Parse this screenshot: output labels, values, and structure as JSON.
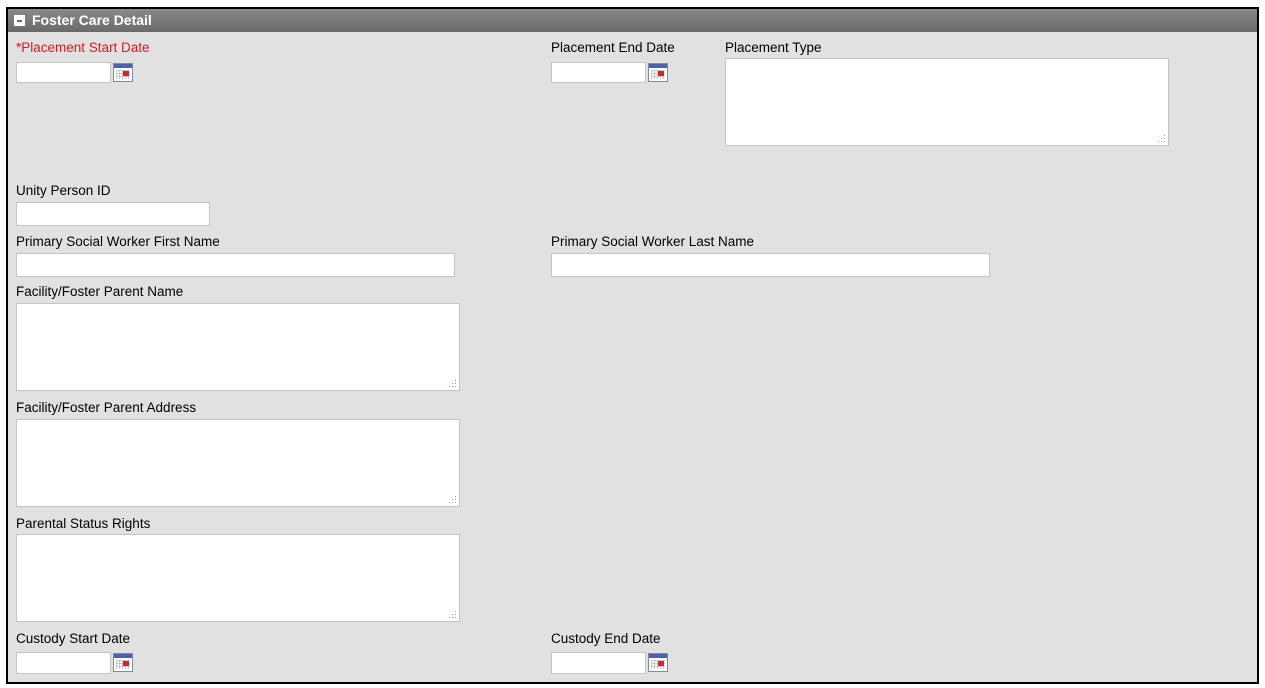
{
  "section": {
    "title": "Foster Care Detail"
  },
  "fields": {
    "placement_start_date": {
      "label": "*Placement Start Date",
      "value": ""
    },
    "placement_end_date": {
      "label": "Placement End Date",
      "value": ""
    },
    "placement_type": {
      "label": "Placement Type",
      "value": ""
    },
    "unity_person_id": {
      "label": "Unity Person ID",
      "value": ""
    },
    "primary_sw_first_name": {
      "label": "Primary Social Worker First Name",
      "value": ""
    },
    "primary_sw_last_name": {
      "label": "Primary Social Worker Last Name",
      "value": ""
    },
    "facility_parent_name": {
      "label": "Facility/Foster Parent Name",
      "value": ""
    },
    "facility_parent_address": {
      "label": "Facility/Foster Parent Address",
      "value": ""
    },
    "parental_status_rights": {
      "label": "Parental Status Rights",
      "value": ""
    },
    "custody_start_date": {
      "label": "Custody Start Date",
      "value": ""
    },
    "custody_end_date": {
      "label": "Custody End Date",
      "value": ""
    }
  },
  "icons": {
    "section_toggle": "collapse-icon",
    "date_picker": "calendar-icon"
  },
  "colors": {
    "required": "#e0161e",
    "header": "#6a6a6a",
    "panel": "#e1e1e1"
  }
}
